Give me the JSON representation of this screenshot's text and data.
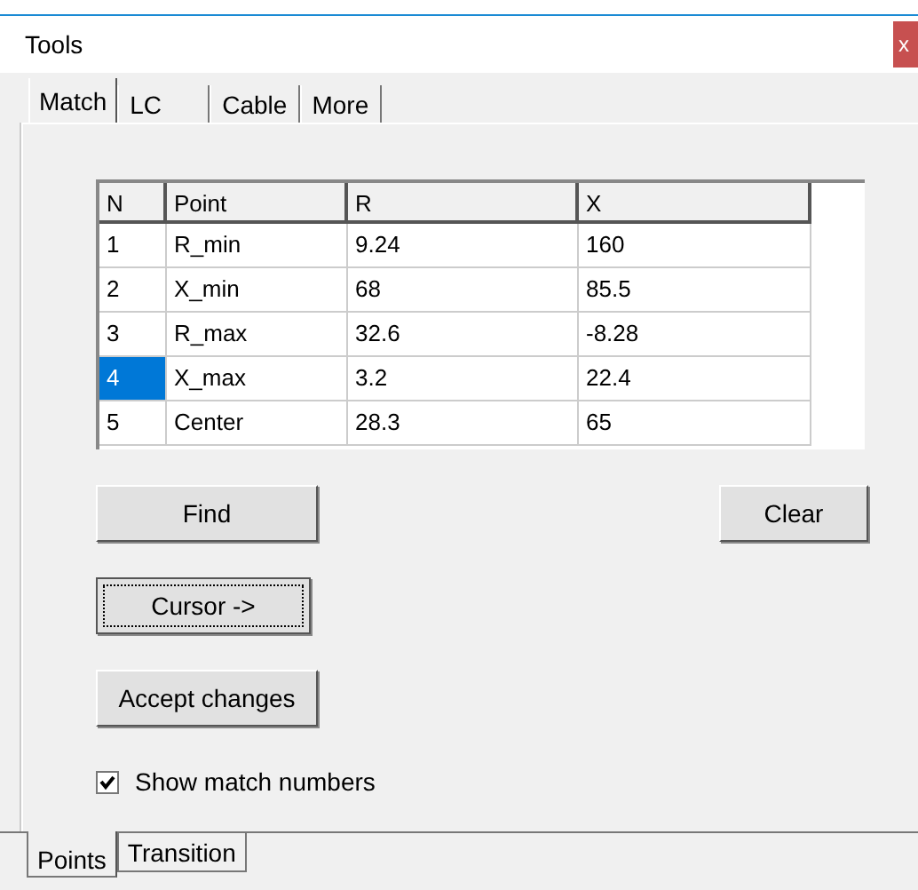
{
  "window": {
    "title": "Tools",
    "close": "x"
  },
  "tabs": [
    {
      "label": "Match",
      "selected": true
    },
    {
      "label": "LC",
      "selected": false
    },
    {
      "label": "Cable",
      "selected": false
    },
    {
      "label": "More",
      "selected": false
    }
  ],
  "table": {
    "columns": [
      "N",
      "Point",
      "R",
      "X"
    ],
    "rows": [
      {
        "cells": [
          "1",
          "R_min",
          "9.24",
          "160"
        ],
        "selected": false
      },
      {
        "cells": [
          "2",
          "X_min",
          "68",
          "85.5"
        ],
        "selected": false
      },
      {
        "cells": [
          "3",
          "R_max",
          "32.6",
          "-8.28"
        ],
        "selected": false
      },
      {
        "cells": [
          "4",
          "X_max",
          "3.2",
          "22.4"
        ],
        "selected": true
      },
      {
        "cells": [
          "5",
          "Center",
          "28.3",
          "65"
        ],
        "selected": false
      }
    ]
  },
  "buttons": {
    "find": {
      "label": "Find",
      "focused": false
    },
    "clear": {
      "label": "Clear",
      "focused": false
    },
    "cursor": {
      "label": "Cursor ->",
      "focused": true
    },
    "accept": {
      "label": "Accept changes",
      "focused": false
    }
  },
  "show_match_numbers": {
    "label": "Show match numbers",
    "checked": true
  },
  "bottom_tabs": [
    {
      "label": "Points",
      "selected": true
    },
    {
      "label": "Transition",
      "selected": false
    }
  ]
}
